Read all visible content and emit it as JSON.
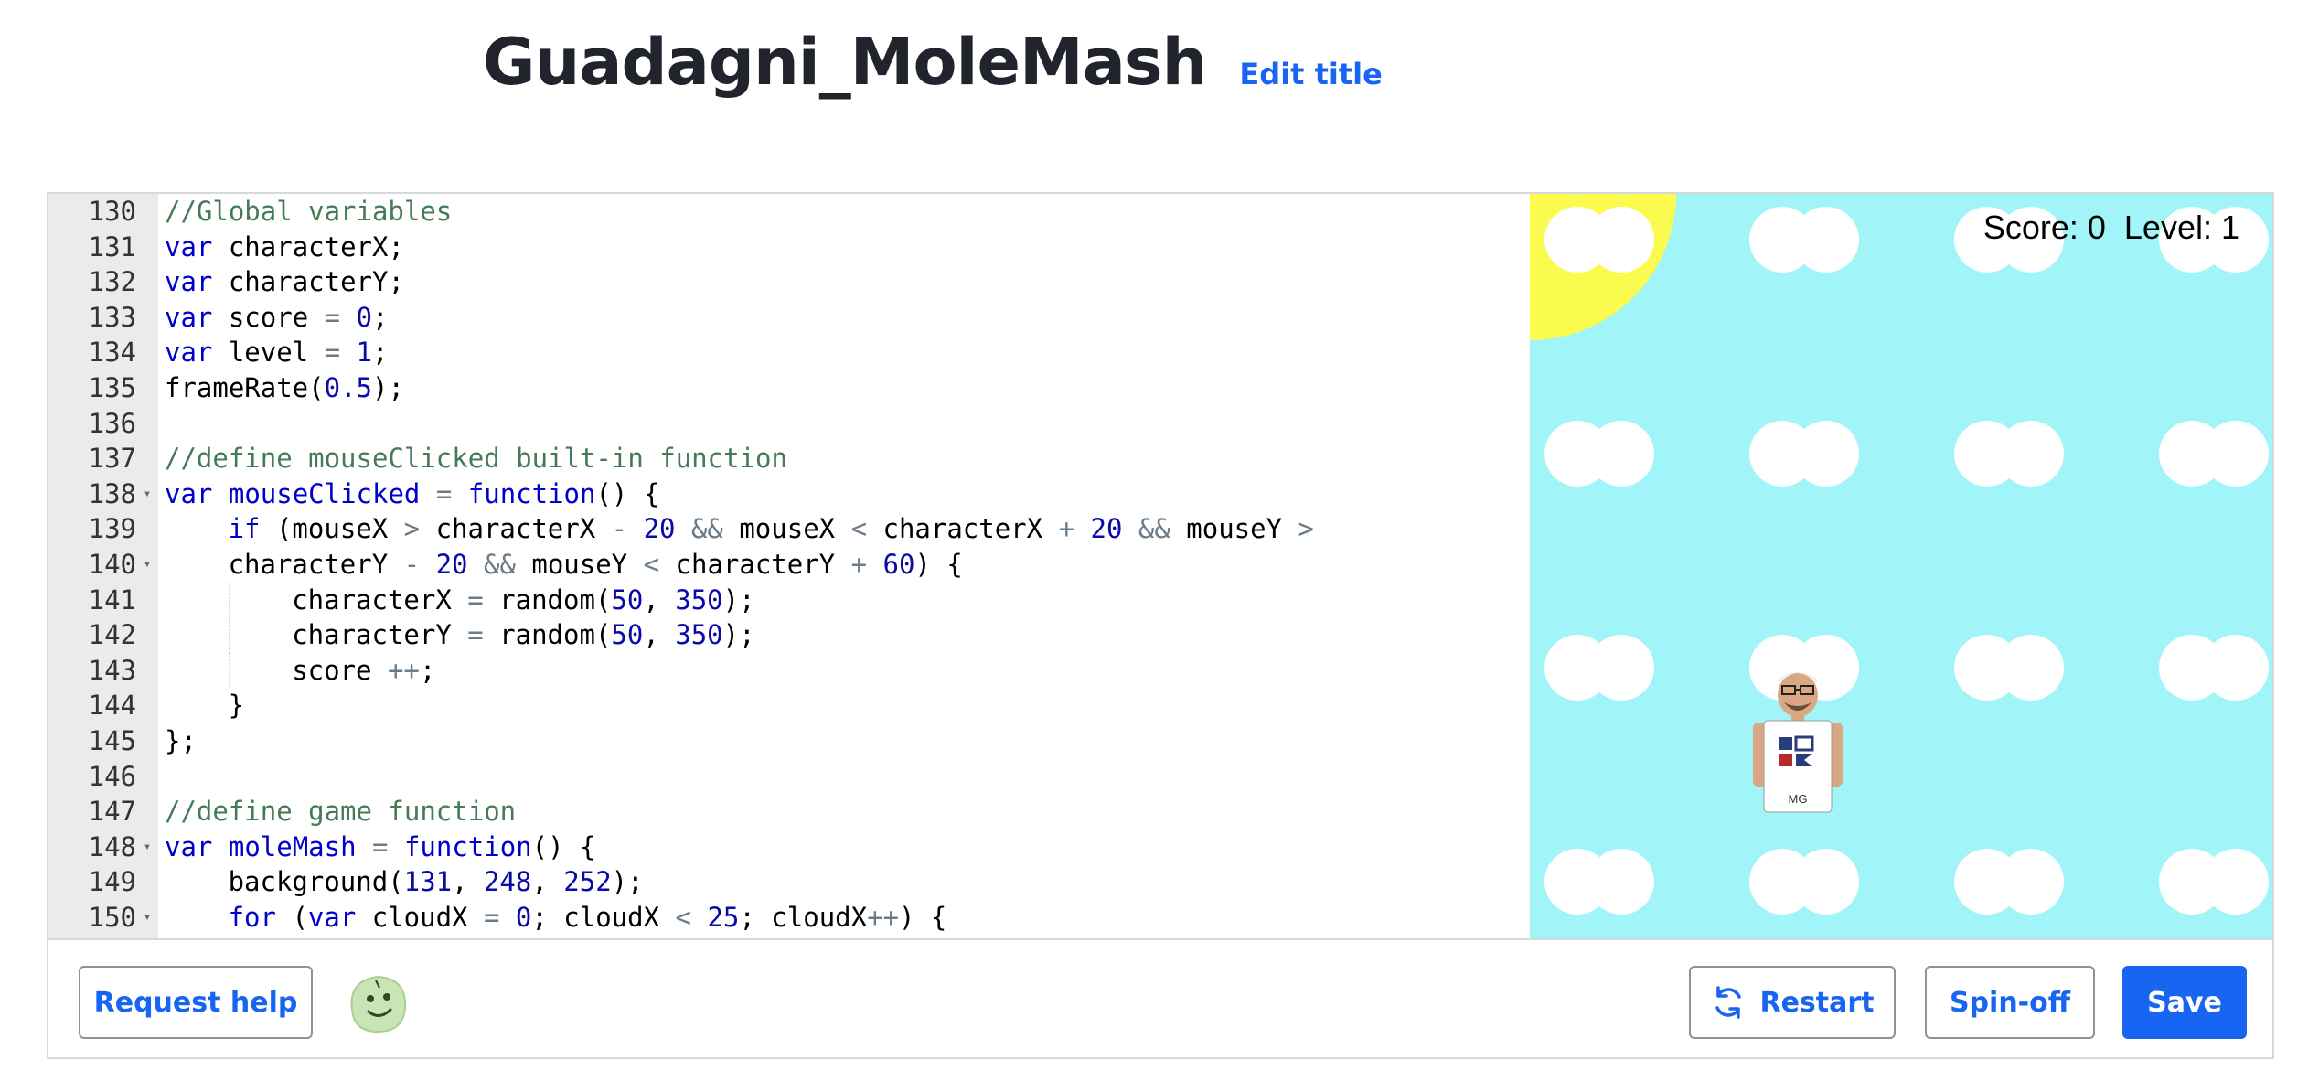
{
  "header": {
    "title": "Guadagni_MoleMash",
    "edit_title_label": "Edit title"
  },
  "editor": {
    "lines": [
      {
        "n": "130",
        "fold": false,
        "indent": 0,
        "tokens": [
          [
            "cm",
            "//Global variables"
          ]
        ]
      },
      {
        "n": "131",
        "fold": false,
        "indent": 0,
        "tokens": [
          [
            "kw",
            "var"
          ],
          [
            "tx",
            " characterX;"
          ]
        ]
      },
      {
        "n": "132",
        "fold": false,
        "indent": 0,
        "tokens": [
          [
            "kw",
            "var"
          ],
          [
            "tx",
            " characterY;"
          ]
        ]
      },
      {
        "n": "133",
        "fold": false,
        "indent": 0,
        "tokens": [
          [
            "kw",
            "var"
          ],
          [
            "tx",
            " score "
          ],
          [
            "op",
            "="
          ],
          [
            "tx",
            " "
          ],
          [
            "nu",
            "0"
          ],
          [
            "tx",
            ";"
          ]
        ]
      },
      {
        "n": "134",
        "fold": false,
        "indent": 0,
        "tokens": [
          [
            "kw",
            "var"
          ],
          [
            "tx",
            " level "
          ],
          [
            "op",
            "="
          ],
          [
            "tx",
            " "
          ],
          [
            "nu",
            "1"
          ],
          [
            "tx",
            ";"
          ]
        ]
      },
      {
        "n": "135",
        "fold": false,
        "indent": 0,
        "tokens": [
          [
            "tx",
            "frameRate("
          ],
          [
            "nu",
            "0.5"
          ],
          [
            "tx",
            ");"
          ]
        ]
      },
      {
        "n": "136",
        "fold": false,
        "indent": 0,
        "tokens": []
      },
      {
        "n": "137",
        "fold": false,
        "indent": 0,
        "tokens": [
          [
            "cm",
            "//define mouseClicked built-in function"
          ]
        ]
      },
      {
        "n": "138",
        "fold": true,
        "indent": 0,
        "tokens": [
          [
            "kw",
            "var"
          ],
          [
            "tx",
            " "
          ],
          [
            "kw",
            "mouseClicked"
          ],
          [
            "tx",
            " "
          ],
          [
            "op",
            "="
          ],
          [
            "tx",
            " "
          ],
          [
            "kw",
            "function"
          ],
          [
            "tx",
            "() {"
          ]
        ]
      },
      {
        "n": "139",
        "fold": false,
        "indent": 1,
        "tokens": [
          [
            "kw",
            "if"
          ],
          [
            "tx",
            " (mouseX "
          ],
          [
            "op",
            ">"
          ],
          [
            "tx",
            " characterX "
          ],
          [
            "op",
            "-"
          ],
          [
            "tx",
            " "
          ],
          [
            "nu",
            "20"
          ],
          [
            "tx",
            " "
          ],
          [
            "op",
            "&&"
          ],
          [
            "tx",
            " mouseX "
          ],
          [
            "op",
            "<"
          ],
          [
            "tx",
            " characterX "
          ],
          [
            "op",
            "+"
          ],
          [
            "tx",
            " "
          ],
          [
            "nu",
            "20"
          ],
          [
            "tx",
            " "
          ],
          [
            "op",
            "&&"
          ],
          [
            "tx",
            " mouseY "
          ],
          [
            "op",
            ">"
          ]
        ]
      },
      {
        "n": "140",
        "fold": true,
        "indent": 1,
        "tokens": [
          [
            "tx",
            "characterY "
          ],
          [
            "op",
            "-"
          ],
          [
            "tx",
            " "
          ],
          [
            "nu",
            "20"
          ],
          [
            "tx",
            " "
          ],
          [
            "op",
            "&&"
          ],
          [
            "tx",
            " mouseY "
          ],
          [
            "op",
            "<"
          ],
          [
            "tx",
            " characterY "
          ],
          [
            "op",
            "+"
          ],
          [
            "tx",
            " "
          ],
          [
            "nu",
            "60"
          ],
          [
            "tx",
            ") {"
          ]
        ]
      },
      {
        "n": "141",
        "fold": false,
        "indent": 2,
        "tokens": [
          [
            "tx",
            "characterX "
          ],
          [
            "op",
            "="
          ],
          [
            "tx",
            " random("
          ],
          [
            "nu",
            "50"
          ],
          [
            "tx",
            ", "
          ],
          [
            "nu",
            "350"
          ],
          [
            "tx",
            ");"
          ]
        ]
      },
      {
        "n": "142",
        "fold": false,
        "indent": 2,
        "tokens": [
          [
            "tx",
            "characterY "
          ],
          [
            "op",
            "="
          ],
          [
            "tx",
            " random("
          ],
          [
            "nu",
            "50"
          ],
          [
            "tx",
            ", "
          ],
          [
            "nu",
            "350"
          ],
          [
            "tx",
            ");"
          ]
        ]
      },
      {
        "n": "143",
        "fold": false,
        "indent": 2,
        "tokens": [
          [
            "tx",
            "score "
          ],
          [
            "op",
            "++"
          ],
          [
            "tx",
            ";"
          ]
        ]
      },
      {
        "n": "144",
        "fold": false,
        "indent": 1,
        "tokens": [
          [
            "tx",
            "}"
          ]
        ]
      },
      {
        "n": "145",
        "fold": false,
        "indent": 0,
        "tokens": [
          [
            "tx",
            "};"
          ]
        ]
      },
      {
        "n": "146",
        "fold": false,
        "indent": 0,
        "tokens": []
      },
      {
        "n": "147",
        "fold": false,
        "indent": 0,
        "tokens": [
          [
            "cm",
            "//define game function"
          ]
        ]
      },
      {
        "n": "148",
        "fold": true,
        "indent": 0,
        "tokens": [
          [
            "kw",
            "var"
          ],
          [
            "tx",
            " "
          ],
          [
            "kw",
            "moleMash"
          ],
          [
            "tx",
            " "
          ],
          [
            "op",
            "="
          ],
          [
            "tx",
            " "
          ],
          [
            "kw",
            "function"
          ],
          [
            "tx",
            "() {"
          ]
        ]
      },
      {
        "n": "149",
        "fold": false,
        "indent": 1,
        "tokens": [
          [
            "tx",
            "background("
          ],
          [
            "nu",
            "131"
          ],
          [
            "tx",
            ", "
          ],
          [
            "nu",
            "248"
          ],
          [
            "tx",
            ", "
          ],
          [
            "nu",
            "252"
          ],
          [
            "tx",
            ");"
          ]
        ]
      },
      {
        "n": "150",
        "fold": true,
        "indent": 1,
        "tokens": [
          [
            "kw",
            "for"
          ],
          [
            "tx",
            " ("
          ],
          [
            "kw",
            "var"
          ],
          [
            "tx",
            " cloudX "
          ],
          [
            "op",
            "="
          ],
          [
            "tx",
            " "
          ],
          [
            "nu",
            "0"
          ],
          [
            "tx",
            "; cloudX "
          ],
          [
            "op",
            "<"
          ],
          [
            "tx",
            " "
          ],
          [
            "nu",
            "25"
          ],
          [
            "tx",
            "; cloudX"
          ],
          [
            "op",
            "++"
          ],
          [
            "tx",
            ") {"
          ]
        ]
      }
    ]
  },
  "canvas": {
    "score_text": "Score: 0  Level: 1",
    "shirt_initials": "MG",
    "colors": {
      "sky": "#a1f5f8",
      "sun": "#fbfb4f",
      "cloud": "#ffffff"
    }
  },
  "footer": {
    "request_help_label": "Request help",
    "restart_label": "Restart",
    "spinoff_label": "Spin-off",
    "save_label": "Save"
  },
  "colors": {
    "accent": "#1865f2",
    "title": "#21242c",
    "gutter": "#ebebeb",
    "border": "#d6d8da"
  }
}
